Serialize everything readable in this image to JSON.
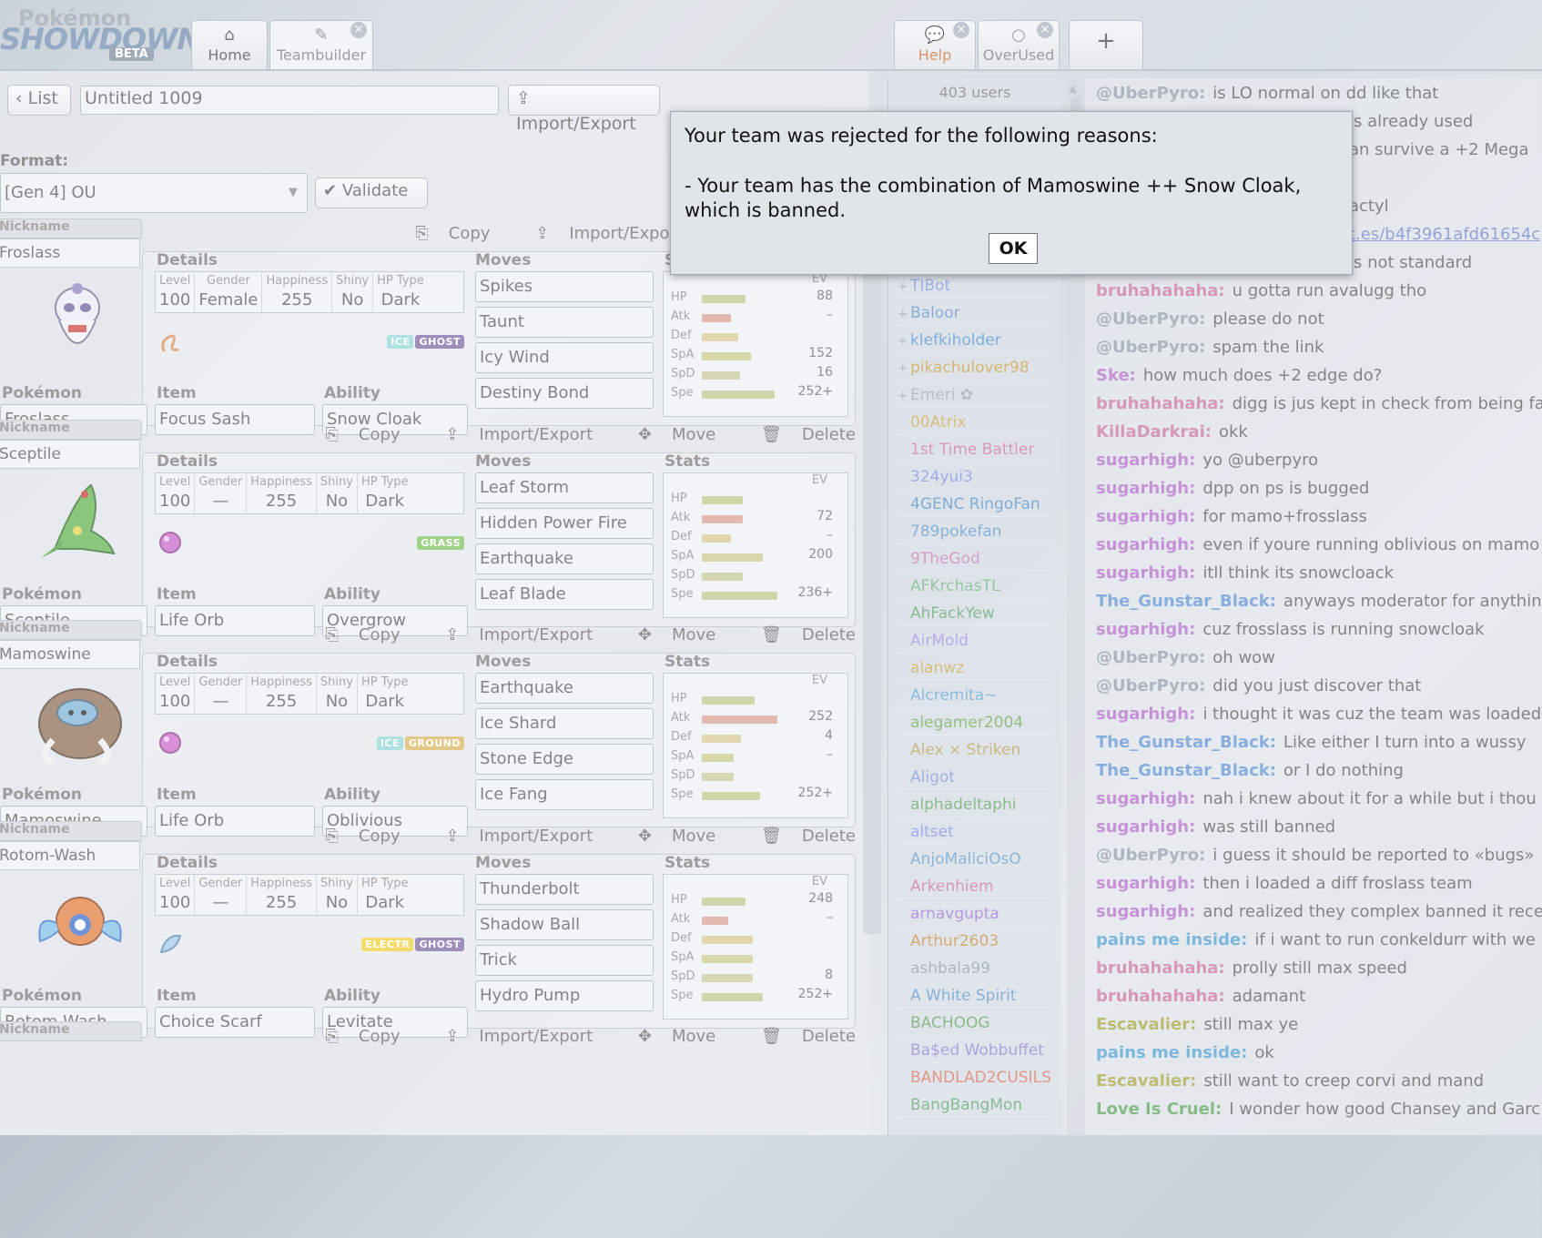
{
  "logo": {
    "line1": "Pokémon",
    "line2": "SHOWDOWN",
    "badge": "BETA"
  },
  "tabs": {
    "home": {
      "label": "Home"
    },
    "teambuilder": {
      "label": "Teambuilder"
    },
    "help": {
      "label": "Help"
    },
    "overused": {
      "label": "OverUsed"
    },
    "new_tab": {
      "label": "+"
    }
  },
  "teambuilder": {
    "list_label": "List",
    "team_name": "Untitled 1009",
    "import_export": "Import/Export",
    "format_label": "Format:",
    "format_value": "[Gen 4] OU",
    "validate_label": "Validate",
    "labels": {
      "nickname": "Nickname",
      "details": "Details",
      "moves": "Moves",
      "stats": "Stats",
      "ev": "EV",
      "pokemon": "Pokémon",
      "item": "Item",
      "ability": "Ability",
      "level": "Level",
      "gender": "Gender",
      "happiness": "Happiness",
      "shiny": "Shiny",
      "hptype": "HP Type",
      "copy": "Copy",
      "import_export": "Import/Export",
      "move": "Move",
      "delete": "Delete",
      "hp": "HP",
      "atk": "Atk",
      "def": "Def",
      "spa": "SpA",
      "spd": "SpD",
      "spe": "Spe"
    },
    "pokemon": [
      {
        "nickname": "Froslass",
        "level": "100",
        "gender": "Female",
        "happiness": "255",
        "shiny": "No",
        "hptype": "Dark",
        "species": "Froslass",
        "item": "Focus Sash",
        "ability": "Snow Cloak",
        "types": [
          {
            "name": "ICE",
            "color": "#8fd6d6"
          },
          {
            "name": "GHOST",
            "color": "#7b62a3"
          }
        ],
        "moves": [
          "Spikes",
          "Taunt",
          "Icy Wind",
          "Destiny Bond"
        ],
        "evs": {
          "hp": "88",
          "atk": "–",
          "def": "",
          "spa": "152",
          "spd": "16",
          "spe": "252+"
        },
        "bars": {
          "hp": 0.3,
          "atk": 0.2,
          "def": 0.25,
          "spa": 0.34,
          "spd": 0.26,
          "spe": 0.5
        }
      },
      {
        "nickname": "Sceptile",
        "level": "100",
        "gender": "—",
        "happiness": "255",
        "shiny": "No",
        "hptype": "Dark",
        "species": "Sceptile",
        "item": "Life Orb",
        "ability": "Overgrow",
        "types": [
          {
            "name": "GRASS",
            "color": "#7cc35a"
          }
        ],
        "moves": [
          "Leaf Storm",
          "Hidden Power Fire",
          "Earthquake",
          "Leaf Blade"
        ],
        "evs": {
          "hp": "",
          "atk": "72",
          "def": "–",
          "spa": "200",
          "spd": "",
          "spe": "236+"
        },
        "bars": {
          "hp": 0.28,
          "atk": 0.28,
          "def": 0.2,
          "spa": 0.42,
          "spd": 0.28,
          "spe": 0.52
        }
      },
      {
        "nickname": "Mamoswine",
        "level": "100",
        "gender": "—",
        "happiness": "255",
        "shiny": "No",
        "hptype": "Dark",
        "species": "Mamoswine",
        "item": "Life Orb",
        "ability": "Oblivious",
        "types": [
          {
            "name": "ICE",
            "color": "#8fd6d6"
          },
          {
            "name": "GROUND",
            "color": "#d9b55a"
          }
        ],
        "moves": [
          "Earthquake",
          "Ice Shard",
          "Stone Edge",
          "Ice Fang"
        ],
        "evs": {
          "hp": "",
          "atk": "252",
          "def": "4",
          "spa": "–",
          "spd": "",
          "spe": "252+"
        },
        "bars": {
          "hp": 0.36,
          "atk": 0.52,
          "def": 0.27,
          "spa": 0.22,
          "spd": 0.22,
          "spe": 0.4
        }
      },
      {
        "nickname": "Rotom-Wash",
        "level": "100",
        "gender": "—",
        "happiness": "255",
        "shiny": "No",
        "hptype": "Dark",
        "species": "Rotom-Wash",
        "item": "Choice Scarf",
        "ability": "Levitate",
        "types": [
          {
            "name": "ELECTR",
            "color": "#efcd35"
          },
          {
            "name": "GHOST",
            "color": "#7b62a3"
          }
        ],
        "moves": [
          "Thunderbolt",
          "Shadow Ball",
          "Trick",
          "Hydro Pump"
        ],
        "evs": {
          "hp": "248",
          "atk": "–",
          "def": "",
          "spa": "",
          "spd": "8",
          "spe": "252+"
        },
        "bars": {
          "hp": 0.3,
          "atk": 0.18,
          "def": 0.35,
          "spa": 0.35,
          "spd": 0.35,
          "spe": 0.42
        }
      }
    ]
  },
  "userlist": {
    "count": "403 users",
    "users": [
      {
        "rank": "+",
        "name": "TIBot",
        "color": "#7b92d9"
      },
      {
        "rank": "+",
        "name": "Baloor",
        "color": "#5f8fc7"
      },
      {
        "rank": "+",
        "name": "klefkiholder",
        "color": "#4d8fd1"
      },
      {
        "rank": "+",
        "name": "pikachulover98",
        "color": "#c59a3e"
      },
      {
        "rank": "+",
        "name": "Emeri ✿",
        "color": "#9aa4ae"
      },
      {
        "rank": "",
        "name": "00Atrix",
        "color": "#c9a34c"
      },
      {
        "rank": "",
        "name": "1st Time Battler",
        "color": "#c8709c"
      },
      {
        "rank": "",
        "name": "324yui3",
        "color": "#7d8be0"
      },
      {
        "rank": "",
        "name": "4GENC RingoFan",
        "color": "#4c8cc4"
      },
      {
        "rank": "",
        "name": "789pokefan",
        "color": "#5a94c9"
      },
      {
        "rank": "",
        "name": "9TheGod",
        "color": "#c479b5"
      },
      {
        "rank": "",
        "name": "AFKrchasTL",
        "color": "#6cb07a"
      },
      {
        "rank": "",
        "name": "AhFackYew",
        "color": "#5aa06b"
      },
      {
        "rank": "",
        "name": "AirMold",
        "color": "#9a8ee0"
      },
      {
        "rank": "",
        "name": "alanwz",
        "color": "#c9a34c"
      },
      {
        "rank": "",
        "name": "Alcremita~",
        "color": "#5aa2cf"
      },
      {
        "rank": "",
        "name": "alegamer2004",
        "color": "#6aa54f"
      },
      {
        "rank": "",
        "name": "Alex × Striken",
        "color": "#b99a55"
      },
      {
        "rank": "",
        "name": "Aligot",
        "color": "#7b92d9"
      },
      {
        "rank": "",
        "name": "alphadeltaphi",
        "color": "#5fa05a"
      },
      {
        "rank": "",
        "name": "altset",
        "color": "#7d8be0"
      },
      {
        "rank": "",
        "name": "AnjoMaliciOsO",
        "color": "#5f98c8"
      },
      {
        "rank": "",
        "name": "Arkenhiem",
        "color": "#c8709c"
      },
      {
        "rank": "",
        "name": "arnavgupta",
        "color": "#9a6fd0"
      },
      {
        "rank": "",
        "name": "Arthur2603",
        "color": "#c58a3e"
      },
      {
        "rank": "",
        "name": "ashbala99",
        "color": "#8e9aa6"
      },
      {
        "rank": "",
        "name": "A White Spirit",
        "color": "#5a94c9"
      },
      {
        "rank": "",
        "name": "BACHOOG",
        "color": "#5fa05a"
      },
      {
        "rank": "",
        "name": "Ba$ed Wobbuffet",
        "color": "#8a7fd2"
      },
      {
        "rank": "",
        "name": "BANDLAD2CUSILS",
        "color": "#d36e5b"
      },
      {
        "rank": "",
        "name": "BangBangMon",
        "color": "#5aa06b"
      }
    ]
  },
  "chat": {
    "messages": [
      {
        "user": "@UberPyro:",
        "text": "is LO normal on dd like that",
        "color": "#8e9aa6"
      },
      {
        "user": "",
        "text": "is already used",
        "color": "#555"
      },
      {
        "user": "",
        "text": "an survive a +2 Mega",
        "color": "#555"
      },
      {
        "user": "",
        "text": "",
        "color": "#555"
      },
      {
        "user": "",
        "text": "actyl",
        "color": "#555"
      },
      {
        "user": "",
        "text": "t.es/b4f3961afd61654c",
        "color": "#6b7fc7",
        "link": true
      },
      {
        "user": "",
        "text": "is not standard",
        "color": "#555"
      },
      {
        "user": "bruhahahaha:",
        "text": "u gotta run avalugg tho",
        "color": "#c8709c"
      },
      {
        "user": "@UberPyro:",
        "text": "please do not",
        "color": "#8e9aa6"
      },
      {
        "user": "@UberPyro:",
        "text": "spam the link",
        "color": "#8e9aa6"
      },
      {
        "user": "Ske:",
        "text": "how much does +2 edge do?",
        "color": "#b06ac8"
      },
      {
        "user": "bruhahahaha:",
        "text": "digg is jus kept in check from being fa",
        "color": "#c8709c"
      },
      {
        "user": "KillaDarkrai:",
        "text": "okk",
        "color": "#c8709c"
      },
      {
        "user": "sugarhigh:",
        "text": "yo @uberpyro",
        "color": "#b06ac8"
      },
      {
        "user": "sugarhigh:",
        "text": "dpp on ps is bugged",
        "color": "#b06ac8"
      },
      {
        "user": "sugarhigh:",
        "text": "for mamo+frosslass",
        "color": "#b06ac8"
      },
      {
        "user": "sugarhigh:",
        "text": "even if youre running oblivious on mamo",
        "color": "#b06ac8"
      },
      {
        "user": "sugarhigh:",
        "text": "itll think its snowcloack",
        "color": "#b06ac8"
      },
      {
        "user": "The_Gunstar_Black:",
        "text": "anyways moderator for anythin",
        "color": "#5a8fd1"
      },
      {
        "user": "sugarhigh:",
        "text": "cuz frosslass is running snowcloak",
        "color": "#b06ac8"
      },
      {
        "user": "@UberPyro:",
        "text": "oh wow",
        "color": "#8e9aa6"
      },
      {
        "user": "@UberPyro:",
        "text": "did you just discover that",
        "color": "#8e9aa6"
      },
      {
        "user": "sugarhigh:",
        "text": "i thought it was cuz the team was loaded",
        "color": "#b06ac8"
      },
      {
        "user": "The_Gunstar_Black:",
        "text": "Like either I turn into a wussy",
        "color": "#5a8fd1"
      },
      {
        "user": "The_Gunstar_Black:",
        "text": "or I do nothing",
        "color": "#5a8fd1"
      },
      {
        "user": "sugarhigh:",
        "text": "nah i knew about it for a while but i thou",
        "color": "#b06ac8"
      },
      {
        "user": "sugarhigh:",
        "text": "was still banned",
        "color": "#b06ac8"
      },
      {
        "user": "@UberPyro:",
        "text": "i guess it should be reported to «bugs»",
        "color": "#8e9aa6"
      },
      {
        "user": "sugarhigh:",
        "text": "then i loaded a diff froslass team",
        "color": "#b06ac8"
      },
      {
        "user": "sugarhigh:",
        "text": "and realized they complex banned it rece",
        "color": "#b06ac8"
      },
      {
        "user": "pains me inside:",
        "text": "if i want to run conkeldurr with we",
        "color": "#4c9ccf"
      },
      {
        "user": "bruhahahaha:",
        "text": "prolly still max speed",
        "color": "#c8709c"
      },
      {
        "user": "bruhahahaha:",
        "text": "adamant",
        "color": "#c8709c"
      },
      {
        "user": "Escavalier:",
        "text": "still max ye",
        "color": "#a2a33e"
      },
      {
        "user": "pains me inside:",
        "text": "ok",
        "color": "#4c9ccf"
      },
      {
        "user": "Escavalier:",
        "text": "still want to creep corvi and mand",
        "color": "#a2a33e"
      },
      {
        "user": "Love Is Cruel:",
        "text": "I wonder how good Chansey and Garc",
        "color": "#5aa05a"
      }
    ]
  },
  "dialog": {
    "line1": "Your team was rejected for the following reasons:",
    "line2": "- Your team has the combination of Mamoswine ++ Snow Cloak, which is banned.",
    "ok": "OK"
  }
}
